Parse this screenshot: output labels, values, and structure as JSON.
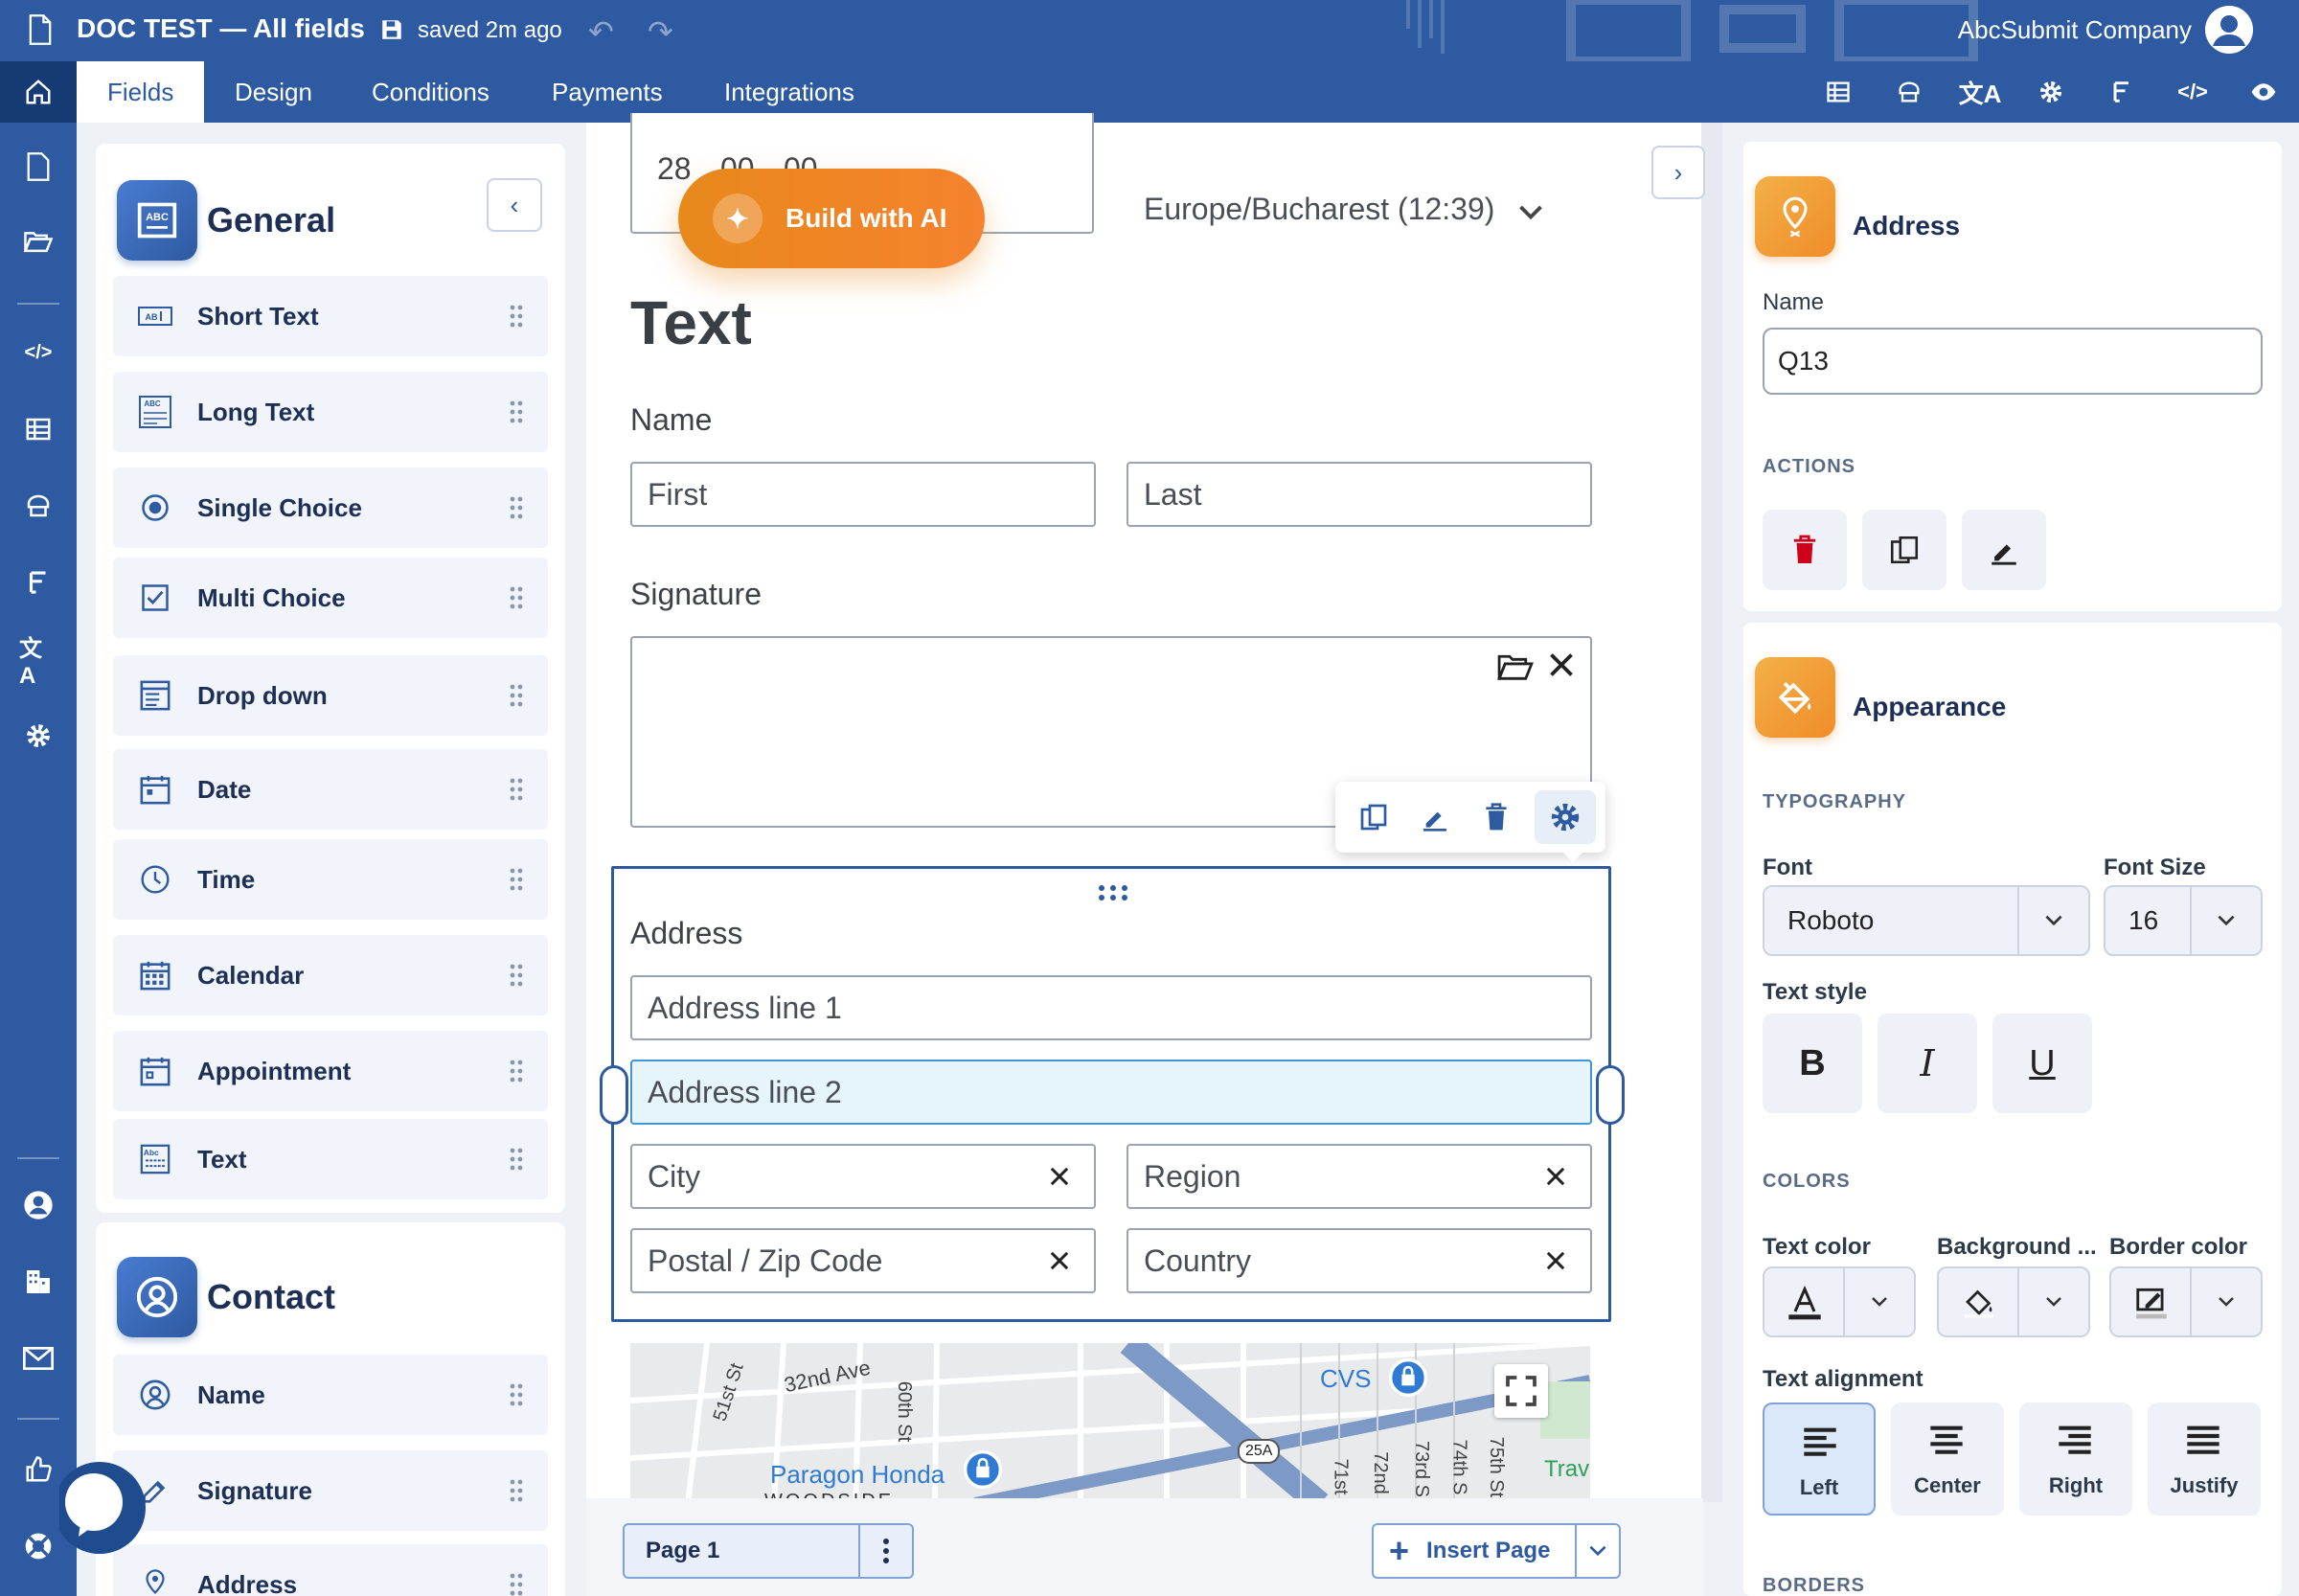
{
  "topbar": {
    "title": "DOC TEST — All fields",
    "saved": "saved 2m ago",
    "company": "AbcSubmit Company"
  },
  "tabs": [
    {
      "label": "Fields",
      "active": true
    },
    {
      "label": "Design"
    },
    {
      "label": "Conditions"
    },
    {
      "label": "Payments"
    },
    {
      "label": "Integrations"
    }
  ],
  "toolbar_icons": [
    "table-icon",
    "template-icon",
    "translate-icon",
    "gear-icon",
    "flow-icon",
    "code-icon",
    "eye-icon"
  ],
  "rail_icons": [
    "document-icon",
    "folder-open-icon",
    "code-icon",
    "table-icon",
    "template-icon",
    "flow-icon",
    "translate-icon",
    "gear-icon",
    "user-circle-icon",
    "building-icon",
    "mail-icon",
    "thumbs-up-icon",
    "lifebuoy-icon"
  ],
  "general": {
    "title": "General",
    "items": [
      {
        "label": "Short Text",
        "icon": "short-text-icon"
      },
      {
        "label": "Long Text",
        "icon": "long-text-icon"
      },
      {
        "label": "Single Choice",
        "icon": "radio-icon"
      },
      {
        "label": "Multi Choice",
        "icon": "checkbox-icon"
      },
      {
        "label": "Drop down",
        "icon": "dropdown-icon"
      },
      {
        "label": "Date",
        "icon": "date-icon"
      },
      {
        "label": "Time",
        "icon": "clock-icon"
      },
      {
        "label": "Calendar",
        "icon": "calendar-icon"
      },
      {
        "label": "Appointment",
        "icon": "appointment-icon"
      },
      {
        "label": "Text",
        "icon": "text-block-icon"
      }
    ]
  },
  "contact": {
    "title": "Contact",
    "items": [
      {
        "label": "Name",
        "icon": "user-circle-icon"
      },
      {
        "label": "Signature",
        "icon": "signature-icon"
      },
      {
        "label": "Address",
        "icon": "pin-icon"
      }
    ]
  },
  "canvas": {
    "time_numbers": [
      "28",
      "00",
      "00"
    ],
    "timezone": "Europe/Bucharest (12:39)",
    "build_ai": "Build with AI",
    "section_title": "Text",
    "name_label": "Name",
    "first_placeholder": "First",
    "last_placeholder": "Last",
    "signature_label": "Signature",
    "address_label": "Address",
    "address_line1": "Address line 1",
    "address_line2": "Address line 2",
    "city": "City",
    "region": "Region",
    "postal": "Postal / Zip Code",
    "country": "Country",
    "map_labels": {
      "ave": "32nd Ave",
      "st51": "51st St",
      "st60": "60th St",
      "cvs": "CVS",
      "paragon": "Paragon Honda",
      "woodside": "WOODSIDE",
      "route": "25A",
      "st71": "71st",
      "st72": "72nd",
      "st73": "73rd S",
      "st74": "74th S",
      "st75": "75th St",
      "trav": "Trav"
    }
  },
  "pagebar": {
    "page": "Page 1",
    "insert": "Insert Page"
  },
  "right": {
    "address_title": "Address",
    "name_label": "Name",
    "name_value": "Q13",
    "actions_label": "ACTIONS",
    "appearance_title": "Appearance",
    "typography_label": "TYPOGRAPHY",
    "font_label": "Font",
    "font_value": "Roboto",
    "font_size_label": "Font Size",
    "font_size_value": "16",
    "text_style_label": "Text style",
    "bold": "B",
    "italic": "I",
    "underline": "U",
    "colors_label": "COLORS",
    "text_color_label": "Text color",
    "background_label": "Background ...",
    "border_color_label": "Border color",
    "text_alignment_label": "Text alignment",
    "align": [
      "Left",
      "Center",
      "Right",
      "Justify"
    ],
    "borders_label": "BORDERS"
  },
  "colors": {
    "primary": "#2d5aa0",
    "rail_dark": "#163a73",
    "accent_orange": "#ef8d2a",
    "delete_red": "#d0021b"
  }
}
